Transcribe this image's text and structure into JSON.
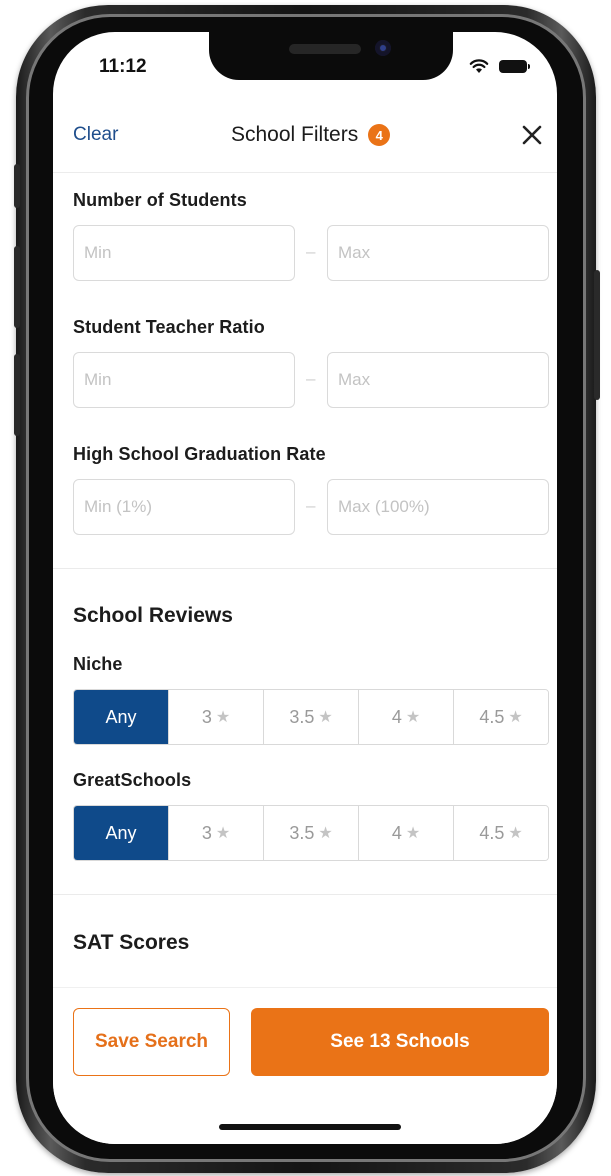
{
  "status_bar": {
    "time": "11:12"
  },
  "header": {
    "clear_label": "Clear",
    "title": "School Filters",
    "badge_count": "4"
  },
  "filters": {
    "students": {
      "label": "Number of Students",
      "min_placeholder": "Min",
      "max_placeholder": "Max"
    },
    "ratio": {
      "label": "Student Teacher Ratio",
      "min_placeholder": "Min",
      "max_placeholder": "Max"
    },
    "graduation": {
      "label": "High School Graduation Rate",
      "min_placeholder": "Min (1%)",
      "max_placeholder": "Max (100%)"
    },
    "separator": "–"
  },
  "reviews": {
    "title": "School Reviews",
    "niche": {
      "label": "Niche",
      "options": [
        "Any",
        "3",
        "3.5",
        "4",
        "4.5"
      ],
      "selected": "Any"
    },
    "greatschools": {
      "label": "GreatSchools",
      "options": [
        "Any",
        "3",
        "3.5",
        "4",
        "4.5"
      ],
      "selected": "Any"
    }
  },
  "sat": {
    "title": "SAT Scores"
  },
  "footer": {
    "save_label": "Save Search",
    "see_label": "See 13 Schools"
  },
  "colors": {
    "accent": "#ea7317",
    "selected": "#0f4a8a",
    "link": "#1f4e8c"
  },
  "icons": {
    "close": "close-icon",
    "star": "star-icon",
    "wifi": "wifi-icon",
    "battery": "battery-icon"
  }
}
